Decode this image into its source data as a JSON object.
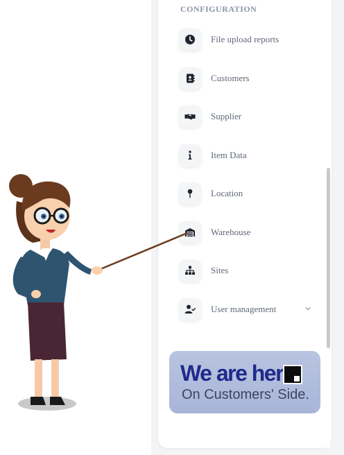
{
  "sidebar": {
    "section_title": "CONFIGURATION",
    "items": [
      {
        "label": "File upload reports",
        "icon": "clock-icon"
      },
      {
        "label": "Customers",
        "icon": "address-book-icon"
      },
      {
        "label": "Supplier",
        "icon": "handshake-icon"
      },
      {
        "label": "Item Data",
        "icon": "info-icon"
      },
      {
        "label": "Location",
        "icon": "map-pin-icon"
      },
      {
        "label": "Warehouse",
        "icon": "warehouse-icon"
      },
      {
        "label": "Sites",
        "icon": "sitemap-icon"
      },
      {
        "label": "User management",
        "icon": "user-check-icon",
        "expandable": true
      }
    ]
  },
  "banner": {
    "line1": "We are here",
    "line2": "On Customers' Side."
  },
  "colors": {
    "icon": "#1f2430",
    "label": "#5f6778",
    "section_title": "#8a93a6",
    "banner_text": "#1f2a8a"
  }
}
